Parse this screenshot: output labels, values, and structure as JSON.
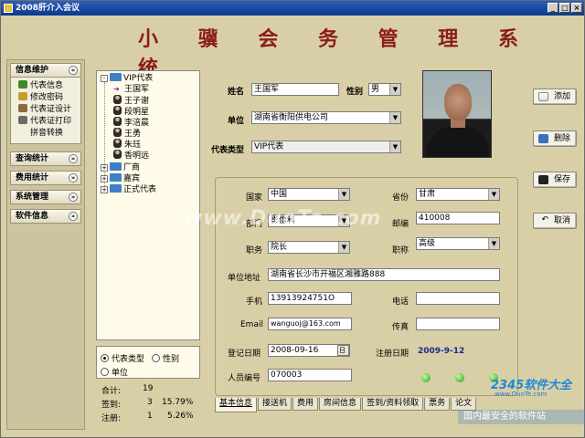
{
  "window": {
    "title": "2008肝介入会议",
    "btn_min": "_",
    "btn_max": "□",
    "btn_close": "×"
  },
  "app_title": "小 骥 会 务 管 理 系 统",
  "sidebar": {
    "sections": [
      {
        "label": "信息维护",
        "expanded": true,
        "items": [
          "代表信息",
          "修改密码",
          "代表证设计",
          "代表证打印",
          "拼音转换"
        ]
      },
      {
        "label": "查询统计",
        "expanded": false
      },
      {
        "label": "费用统计",
        "expanded": false
      },
      {
        "label": "系统管理",
        "expanded": false
      },
      {
        "label": "软件信息",
        "expanded": false
      }
    ],
    "chev_up": "«",
    "chev_down": "»"
  },
  "tree": {
    "root": "VIP代表",
    "children": [
      "王国军",
      "王子谢",
      "段明星",
      "李涪晨",
      "王勇",
      "朱珏",
      "香明远"
    ],
    "others": [
      "厂商",
      "嘉宾",
      "正式代表"
    ]
  },
  "filter": {
    "options": [
      "代表类型",
      "性别",
      "单位"
    ],
    "selected": "代表类型"
  },
  "stats": {
    "total_label": "合计:",
    "total": "19",
    "signed_label": "签到:",
    "signed": "3",
    "signed_pct": "15.79%",
    "registered_label": "注册:",
    "registered": "1",
    "registered_pct": "5.26%"
  },
  "form": {
    "name_label": "姓名",
    "name": "王国军",
    "gender_label": "性别",
    "gender": "男",
    "unit_label": "单位",
    "unit": "湖南省衡阳供电公司",
    "type_label": "代表类型",
    "type": "VIP代表",
    "country_label": "国家",
    "country": "中国",
    "province_label": "省份",
    "province": "甘肃",
    "dept_label": "部门",
    "dept": "影像科",
    "zip_label": "邮编",
    "zip": "410008",
    "position_label": "职务",
    "position": "院长",
    "title_label": "职称",
    "title_value": "高级",
    "address_label": "单位地址",
    "address": "湖南省长沙市开福区湘雅路888",
    "mobile_label": "手机",
    "mobile": "13913924751O",
    "phone_label": "电话",
    "phone": "",
    "email_label": "Email",
    "email": "wanguoj@163.com",
    "fax_label": "传真",
    "fax": "",
    "regdate_label": "登记日期",
    "regdate": "2008-09-16",
    "regdate_btn": "日",
    "signup_label": "注册日期",
    "signup_date": "2009-9-12",
    "staff_label": "人员编号",
    "staff": "070003"
  },
  "buttons": {
    "add": "添加",
    "delete": "删除",
    "save": "保存",
    "cancel": "取消"
  },
  "tabs": [
    "基本信息",
    "接送机",
    "费用",
    "房间信息",
    "签到/资料领取",
    "票务",
    "论文"
  ],
  "watermark": "www.DuoTe.com",
  "logo": {
    "big": "2345软件大全",
    "small": "www.DuoTe.com",
    "strip": "国内最安全的软件站"
  },
  "colors": {
    "title_red": "#8b1c1c",
    "background": "#d8cfa6",
    "titlebar_blue": "#0b3a8e"
  }
}
